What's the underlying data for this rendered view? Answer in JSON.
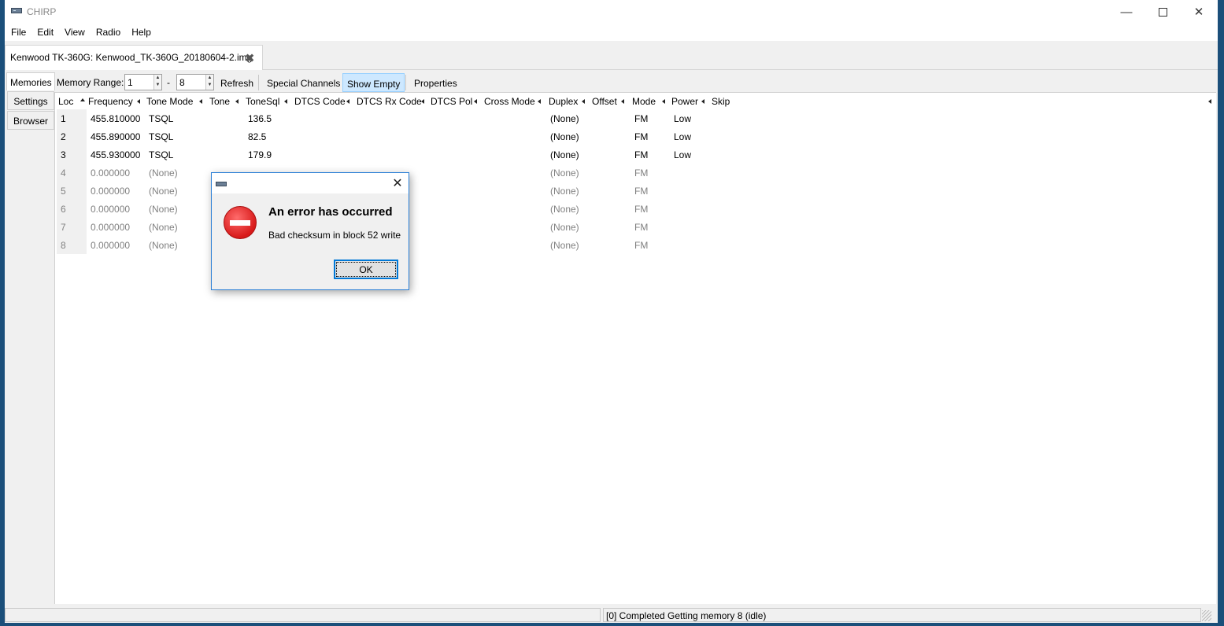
{
  "window": {
    "title": "CHIRP"
  },
  "menu": [
    "File",
    "Edit",
    "View",
    "Radio",
    "Help"
  ],
  "doc_tab": {
    "label": "Kenwood TK-360G: Kenwood_TK-360G_20180604-2.img"
  },
  "toolbar": {
    "memories_tab": "Memories",
    "memory_range_label": "Memory Range:",
    "range_start": "1",
    "range_dash": "-",
    "range_end": "8",
    "refresh": "Refresh",
    "special_channels": "Special Channels",
    "show_empty": "Show Empty",
    "properties": "Properties"
  },
  "side_tabs": [
    "Settings",
    "Browser"
  ],
  "columns": [
    "Loc",
    "Frequency",
    "Tone Mode",
    "Tone",
    "ToneSql",
    "DTCS Code",
    "DTCS Rx Code",
    "DTCS Pol",
    "Cross Mode",
    "Duplex",
    "Offset",
    "Mode",
    "Power",
    "Skip"
  ],
  "rows": [
    {
      "loc": "1",
      "frequency": "455.810000",
      "tone_mode": "TSQL",
      "tonesql": "136.5",
      "duplex": "(None)",
      "mode": "FM",
      "power": "Low"
    },
    {
      "loc": "2",
      "frequency": "455.890000",
      "tone_mode": "TSQL",
      "tonesql": "82.5",
      "duplex": "(None)",
      "mode": "FM",
      "power": "Low"
    },
    {
      "loc": "3",
      "frequency": "455.930000",
      "tone_mode": "TSQL",
      "tonesql": "179.9",
      "duplex": "(None)",
      "mode": "FM",
      "power": "Low"
    },
    {
      "loc": "4",
      "frequency": "0.000000",
      "tone_mode": "(None)",
      "tonesql": "",
      "duplex": "(None)",
      "mode": "FM",
      "power": ""
    },
    {
      "loc": "5",
      "frequency": "0.000000",
      "tone_mode": "(None)",
      "tonesql": "",
      "duplex": "(None)",
      "mode": "FM",
      "power": ""
    },
    {
      "loc": "6",
      "frequency": "0.000000",
      "tone_mode": "(None)",
      "tonesql": "",
      "duplex": "(None)",
      "mode": "FM",
      "power": ""
    },
    {
      "loc": "7",
      "frequency": "0.000000",
      "tone_mode": "(None)",
      "tonesql": "",
      "duplex": "(None)",
      "mode": "FM",
      "power": ""
    },
    {
      "loc": "8",
      "frequency": "0.000000",
      "tone_mode": "(None)",
      "tonesql": "",
      "duplex": "(None)",
      "mode": "FM",
      "power": ""
    }
  ],
  "status": {
    "left": "",
    "right": "[0] Completed Getting memory 8 (idle)"
  },
  "dialog": {
    "heading": "An error has occurred",
    "message": "Bad checksum in block 52 write",
    "ok": "OK"
  }
}
